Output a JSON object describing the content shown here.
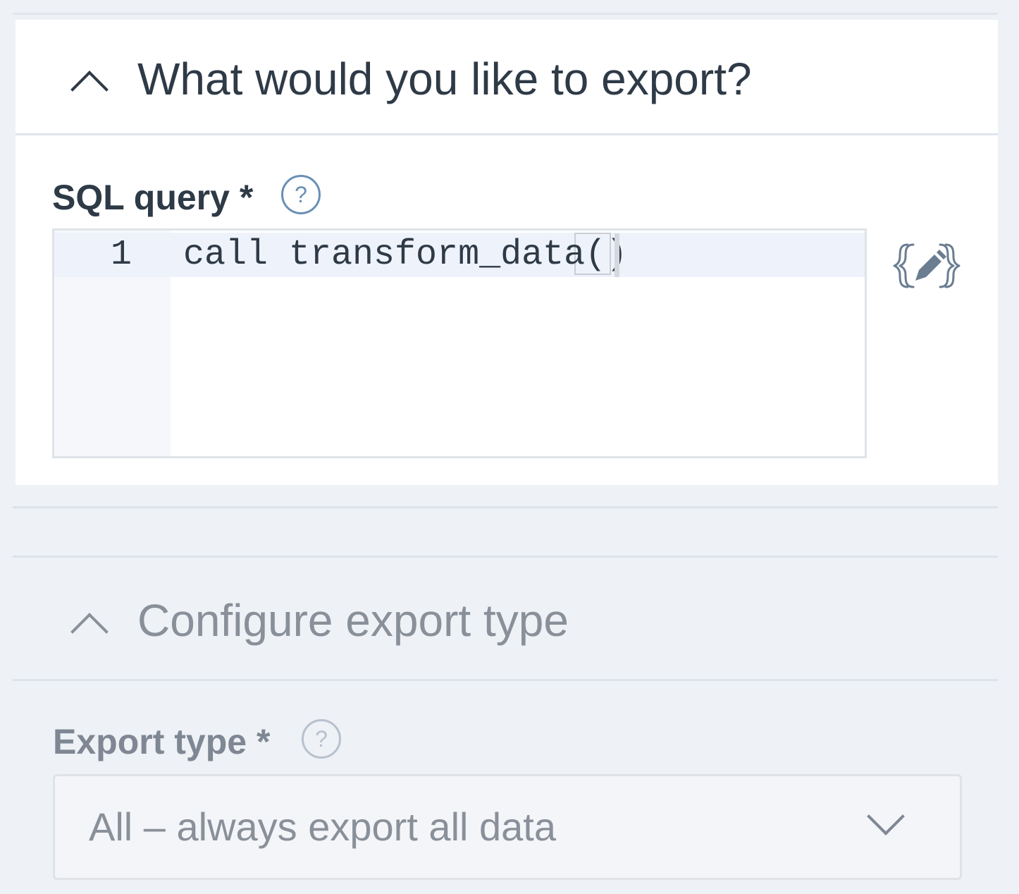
{
  "export_section": {
    "title": "What would you like to export?",
    "sql_query": {
      "label": "SQL query *",
      "help_icon": "?",
      "line_number": "1",
      "code": "call transform_data()"
    }
  },
  "configure_section": {
    "title": "Configure export type",
    "export_type": {
      "label": "Export type *",
      "help_icon": "?",
      "selected_value": "All – always export all data"
    }
  },
  "icons": {
    "collapse": "chevron-up-icon",
    "help": "question-circle-icon",
    "format_code": "json-edit-icon",
    "select_dropdown": "chevron-down-icon"
  },
  "colors": {
    "accent_blue": "#6b8fb5",
    "text_dark": "#2f3a47",
    "text_muted": "#8a9099",
    "panel_background": "#ffffff",
    "page_background": "#eef1f5"
  }
}
